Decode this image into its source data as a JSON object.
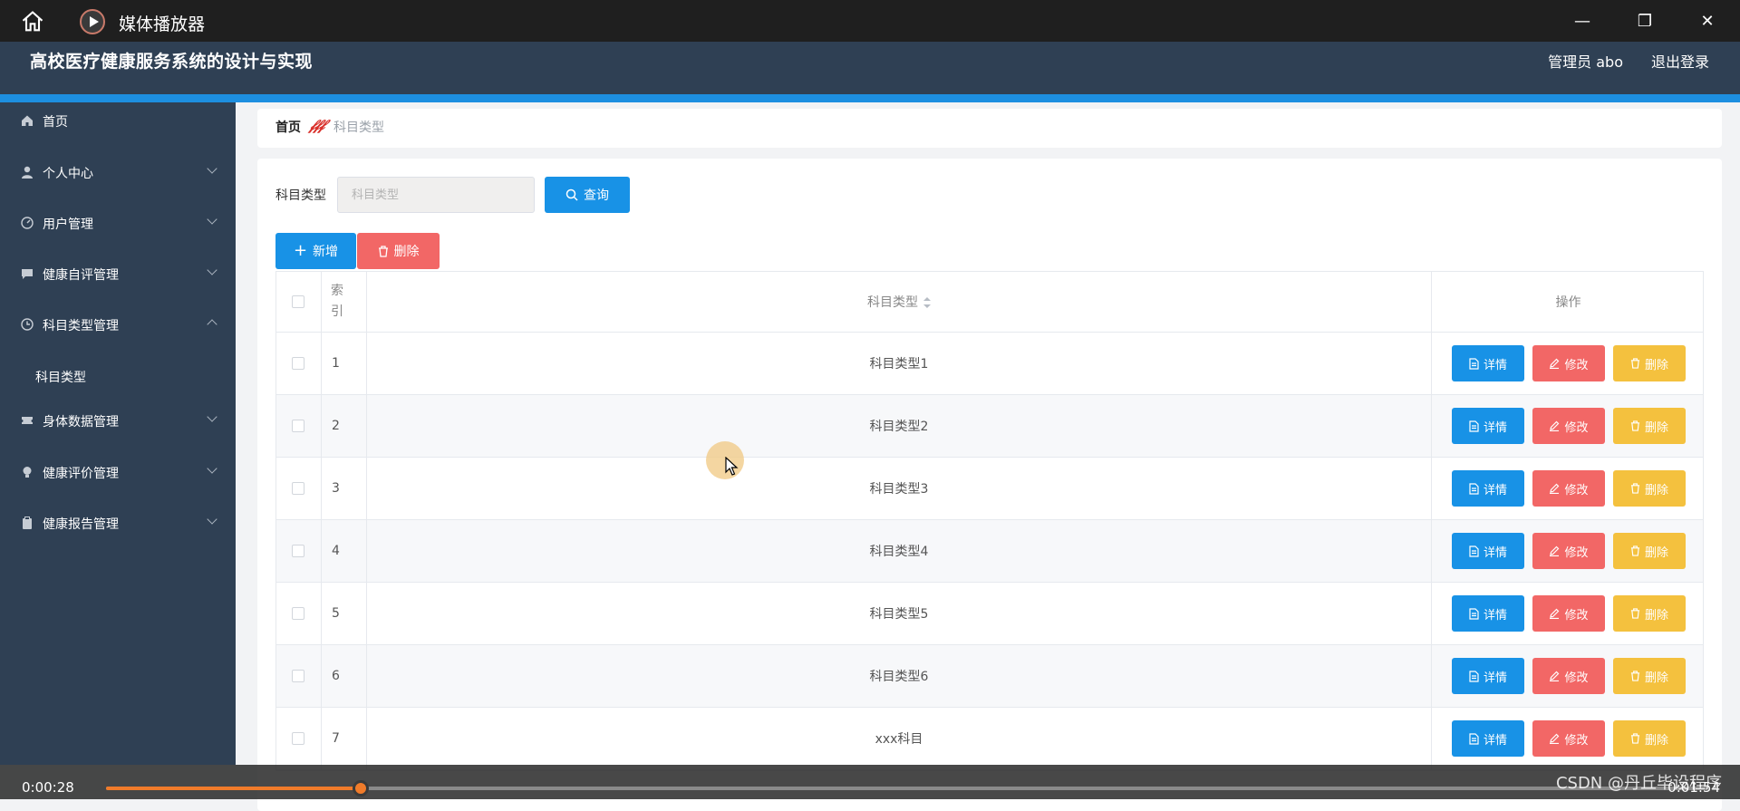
{
  "window": {
    "title": "媒体播放器"
  },
  "header": {
    "title": "高校医疗健康服务系统的设计与实现",
    "user": "管理员 abo",
    "logout": "退出登录"
  },
  "sidebar": {
    "items": [
      {
        "label": "首页",
        "icon": "home-icon"
      },
      {
        "label": "个人中心",
        "icon": "user-icon"
      },
      {
        "label": "用户管理",
        "icon": "gauge-icon"
      },
      {
        "label": "健康自评管理",
        "icon": "chat-icon"
      },
      {
        "label": "科目类型管理",
        "icon": "clock-icon"
      },
      {
        "label": "科目类型",
        "icon": ""
      },
      {
        "label": "身体数据管理",
        "icon": "ticket-icon"
      },
      {
        "label": "健康评价管理",
        "icon": "bulb-icon"
      },
      {
        "label": "健康报告管理",
        "icon": "clipboard-icon"
      }
    ]
  },
  "breadcrumb": {
    "home": "首页",
    "separator": "𝒻𝒻𝒻",
    "current": "科目类型"
  },
  "search": {
    "label": "科目类型",
    "placeholder": "科目类型",
    "query_button": "查询"
  },
  "actions": {
    "add": "新增",
    "delete": "删除"
  },
  "table": {
    "headers": {
      "index": "索引",
      "type": "科目类型",
      "ops": "操作"
    },
    "row_buttons": {
      "detail": "详情",
      "edit": "修改",
      "delete": "删除"
    },
    "rows": [
      {
        "index": "1",
        "type": "科目类型1"
      },
      {
        "index": "2",
        "type": "科目类型2"
      },
      {
        "index": "3",
        "type": "科目类型3"
      },
      {
        "index": "4",
        "type": "科目类型4"
      },
      {
        "index": "5",
        "type": "科目类型5"
      },
      {
        "index": "6",
        "type": "科目类型6"
      },
      {
        "index": "7",
        "type": "xxx科目"
      }
    ]
  },
  "player": {
    "elapsed": "0:00:28",
    "duration": "0:01:54",
    "progress": 0.159
  },
  "watermark": "CSDN @丹丘毕设程序",
  "colors": {
    "primary": "#1892e6",
    "danger": "#f26766",
    "warning": "#f4c13e",
    "sidebar": "#2f4054",
    "accent": "#1d8fe0",
    "progress": "#f07b2a"
  }
}
